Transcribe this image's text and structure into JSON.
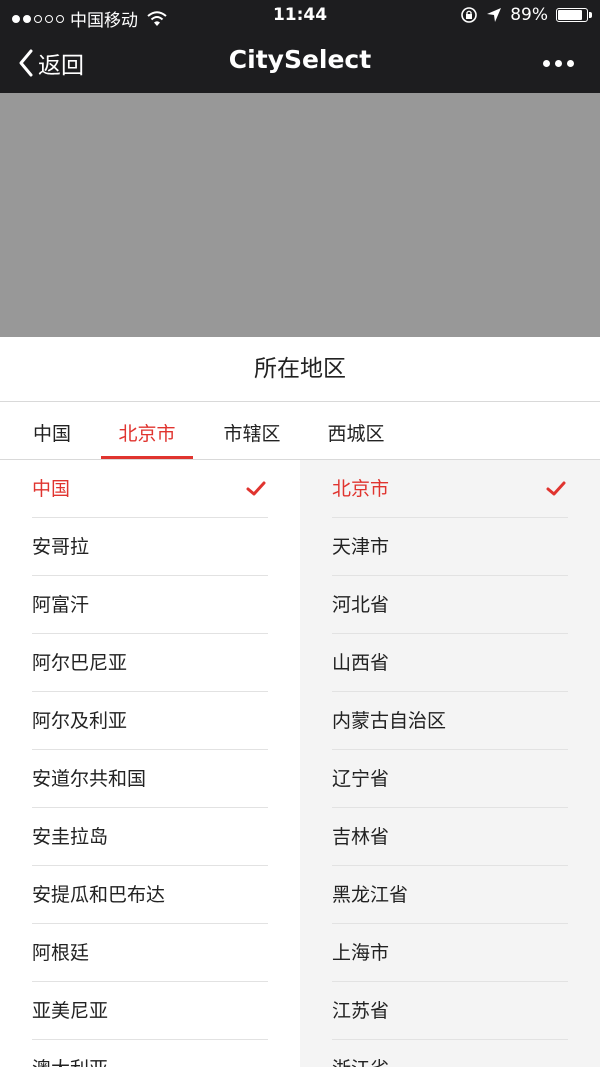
{
  "status_bar": {
    "carrier": "中国移动",
    "time": "11:44",
    "battery": "89%",
    "battery_level": 0.89,
    "signal_bars_filled": 2,
    "signal_bars_total": 5
  },
  "nav": {
    "back_label": "返回",
    "title": "CitySelect"
  },
  "panel": {
    "title": "所在地区",
    "tabs": [
      {
        "label": "中国",
        "active": false
      },
      {
        "label": "北京市",
        "active": true
      },
      {
        "label": "市辖区",
        "active": false
      },
      {
        "label": "西城区",
        "active": false
      }
    ]
  },
  "lists": {
    "left": [
      "中国",
      "安哥拉",
      "阿富汗",
      "阿尔巴尼亚",
      "阿尔及利亚",
      "安道尔共和国",
      "安圭拉岛",
      "安提瓜和巴布达",
      "阿根廷",
      "亚美尼亚",
      "澳大利亚"
    ],
    "left_selected": 0,
    "right": [
      "北京市",
      "天津市",
      "河北省",
      "山西省",
      "内蒙古自治区",
      "辽宁省",
      "吉林省",
      "黑龙江省",
      "上海市",
      "江苏省",
      "浙江省"
    ],
    "right_selected": 0
  },
  "colors": {
    "accent": "#e0342f",
    "nav_background": "#1d1d1f",
    "overlay": "#989898",
    "right_column_background": "#f4f4f4"
  },
  "icons": {
    "back": "chevron-left-icon",
    "more": "more-dots-icon",
    "check": "checkmark-icon",
    "wifi": "wifi-icon",
    "lock_rotation": "rotation-lock-icon",
    "location": "location-arrow-icon",
    "battery": "battery-icon"
  }
}
